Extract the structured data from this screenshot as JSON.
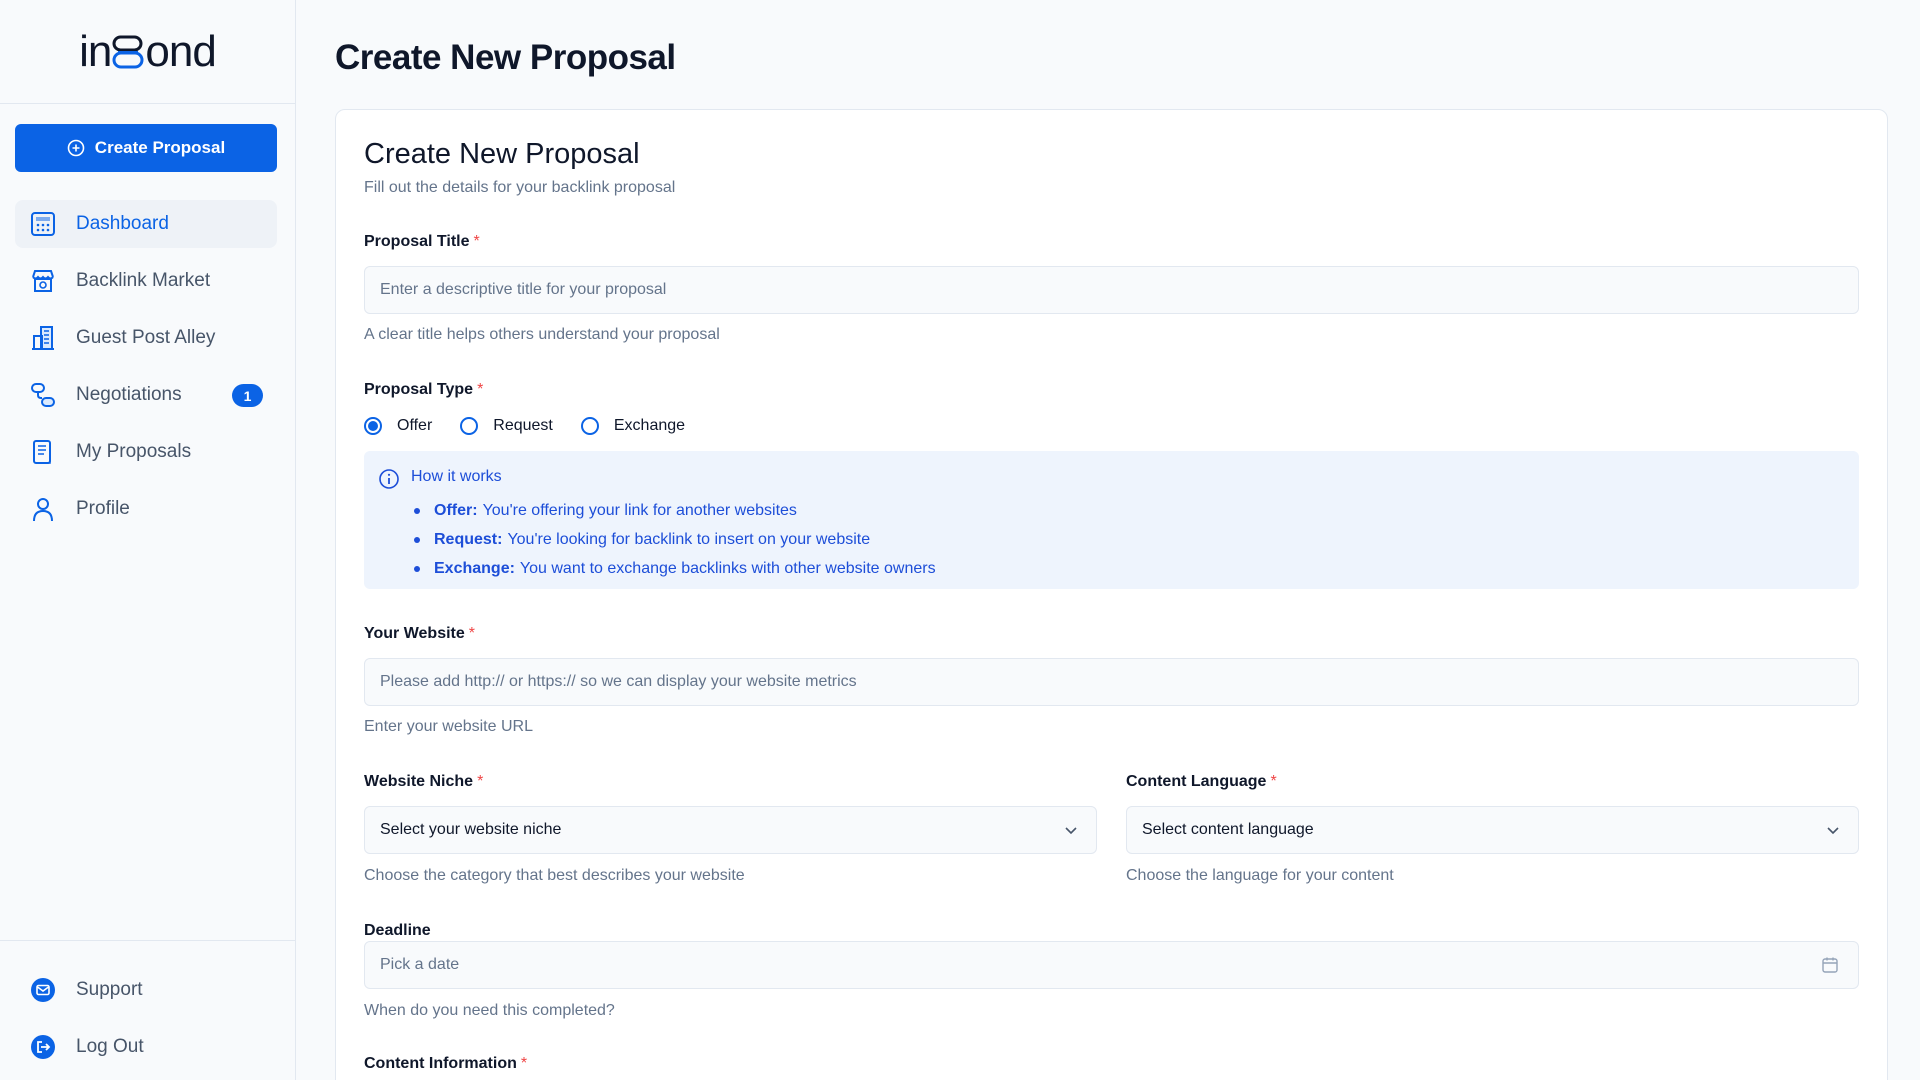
{
  "app": {
    "logo_text_1": "in",
    "logo_text_2": "ond"
  },
  "sidebar": {
    "create_label": "Create Proposal",
    "items": [
      {
        "label": "Dashboard",
        "icon": "calculator-icon",
        "active": true
      },
      {
        "label": "Backlink Market",
        "icon": "store-icon"
      },
      {
        "label": "Guest Post Alley",
        "icon": "building-icon"
      },
      {
        "label": "Negotiations",
        "icon": "route-icon",
        "badge": "1"
      },
      {
        "label": "My Proposals",
        "icon": "document-icon"
      },
      {
        "label": "Profile",
        "icon": "user-icon"
      }
    ],
    "bottom": [
      {
        "label": "Support",
        "icon": "mail-icon"
      },
      {
        "label": "Log Out",
        "icon": "logout-icon"
      }
    ]
  },
  "page": {
    "title": "Create New Proposal"
  },
  "form": {
    "title": "Create New Proposal",
    "subtitle": "Fill out the details for your backlink proposal",
    "proposal_title": {
      "label": "Proposal Title",
      "required": "*",
      "placeholder": "Enter a descriptive title for your proposal",
      "help": "A clear title helps others understand your proposal"
    },
    "proposal_type": {
      "label": "Proposal Type",
      "required": "*",
      "options": [
        "Offer",
        "Request",
        "Exchange"
      ],
      "selected": "Offer"
    },
    "how_it_works": {
      "title": "How it works",
      "items": [
        {
          "term": "Offer:",
          "text": "You're offering your link for another websites"
        },
        {
          "term": "Request:",
          "text": "You're looking for backlink to insert on your website"
        },
        {
          "term": "Exchange:",
          "text": "You want to exchange backlinks with other website owners"
        }
      ]
    },
    "website": {
      "label": "Your Website",
      "required": "*",
      "placeholder": "Please add http:// or https:// so we can display your website metrics",
      "help": "Enter your website URL"
    },
    "niche": {
      "label": "Website Niche",
      "required": "*",
      "value": "Select your website niche",
      "help": "Choose the category that best describes your website"
    },
    "language": {
      "label": "Content Language",
      "required": "*",
      "value": "Select content language",
      "help": "Choose the language for your content"
    },
    "deadline": {
      "label": "Deadline",
      "placeholder": "Pick a date",
      "help": "When do you need this completed?"
    },
    "content_info": {
      "label": "Content Information",
      "required": "*"
    }
  },
  "colors": {
    "primary": "#0b63e5",
    "info_bg": "#eef4fd",
    "required": "#ef4444"
  }
}
